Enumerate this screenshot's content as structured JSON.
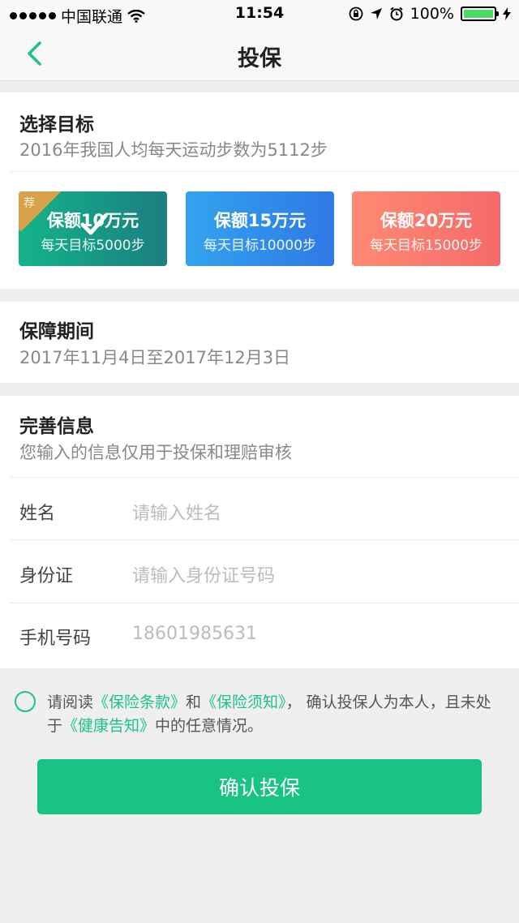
{
  "status": {
    "carrier": "中国联通",
    "time": "11:54",
    "battery": "100%"
  },
  "nav": {
    "title": "投保"
  },
  "target": {
    "title": "选择目标",
    "subtitle": "2016年我国人均每天运动步数为5112步",
    "plans": [
      {
        "amount": "保额10万元",
        "target": "每天目标5000步",
        "badge": "荐",
        "selected": true
      },
      {
        "amount": "保额15万元",
        "target": "每天目标10000步",
        "selected": false
      },
      {
        "amount": "保额20万元",
        "target": "每天目标15000步",
        "selected": false
      }
    ]
  },
  "period": {
    "title": "保障期间",
    "value": "2017年11月4日至2017年12月3日"
  },
  "info": {
    "title": "完善信息",
    "subtitle": "您输入的信息仅用于投保和理赔审核",
    "fields": [
      {
        "label": "姓名",
        "placeholder": "请输入姓名"
      },
      {
        "label": "身份证",
        "placeholder": "请输入身份证号码"
      },
      {
        "label": "手机号码",
        "value": "18601985631"
      }
    ]
  },
  "agreement": {
    "prefix": "请阅读",
    "link1": "《保险条款》",
    "and": "和",
    "link2": "《保险须知》",
    "mid": "， 确认投保人为本人，且未处于",
    "link3": "《健康告知》",
    "suffix": "中的任意情况。"
  },
  "confirm_label": "确认投保",
  "colors": {
    "accent": "#19c386",
    "badge": "#d8a24a"
  }
}
